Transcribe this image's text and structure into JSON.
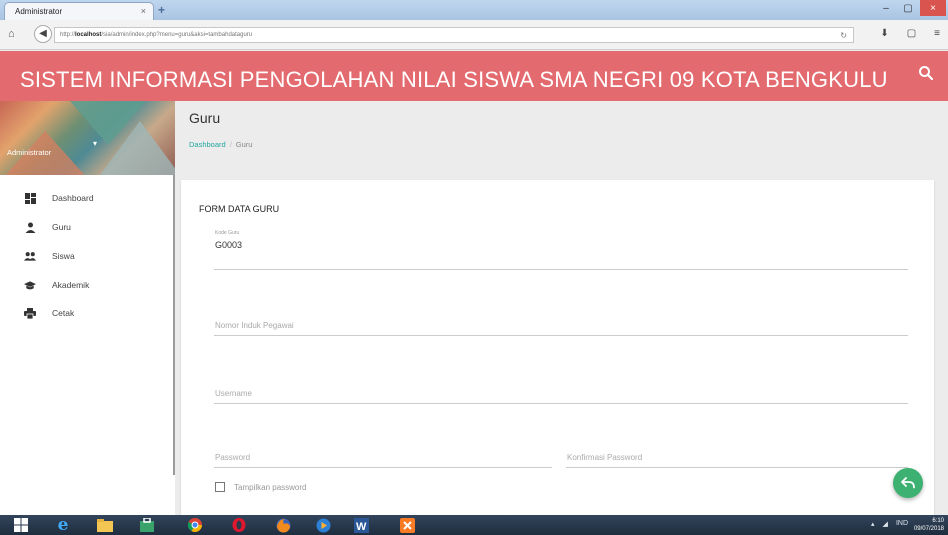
{
  "browser": {
    "tab_title": "Administrator",
    "tab_close": "×",
    "new_tab": "+",
    "url_prefix": "http://",
    "url_host": "localhost",
    "url_path": "/sia/admin/index.php?menu=guru&aksi=tambahdataguru",
    "window_controls": {
      "minimize": "–",
      "maximize": "▢",
      "close": "×"
    }
  },
  "app": {
    "title": "SISTEM INFORMASI PENGOLAHAN NILAI SISWA SMA NEGRI 09 KOTA BENGKULU",
    "header_color": "#e36a6e"
  },
  "profile": {
    "username": "Administrator",
    "caret": "▾"
  },
  "sidebar": {
    "items": [
      {
        "label": "Dashboard",
        "icon": "dashboard-icon"
      },
      {
        "label": "Guru",
        "icon": "person-icon"
      },
      {
        "label": "Siswa",
        "icon": "people-icon"
      },
      {
        "label": "Akademik",
        "icon": "school-icon"
      },
      {
        "label": "Cetak",
        "icon": "print-icon"
      }
    ]
  },
  "page": {
    "title": "Guru",
    "breadcrumb_home": "Dashboard",
    "breadcrumb_sep": "/",
    "breadcrumb_current": "Guru"
  },
  "form": {
    "title": "FORM DATA GURU",
    "kode_guru_label": "Kode Guru",
    "kode_guru_value": "G0003",
    "nip_placeholder": "Nomor Induk Pegawai",
    "username_placeholder": "Username",
    "password_placeholder": "Password",
    "confirm_password_placeholder": "Konfirmasi Password",
    "show_password_label": "Tampilkan password"
  },
  "fab": {
    "icon": "undo-icon",
    "color": "#3cb171"
  },
  "taskbar": {
    "apps": [
      "windows-start-icon",
      "ie-icon",
      "file-explorer-icon",
      "store-icon",
      "chrome-icon",
      "opera-icon",
      "firefox-icon",
      "media-icon",
      "word-icon",
      "xampp-icon"
    ],
    "tray_lang": "IND",
    "time": "6:10",
    "date": "09/07/2018"
  }
}
